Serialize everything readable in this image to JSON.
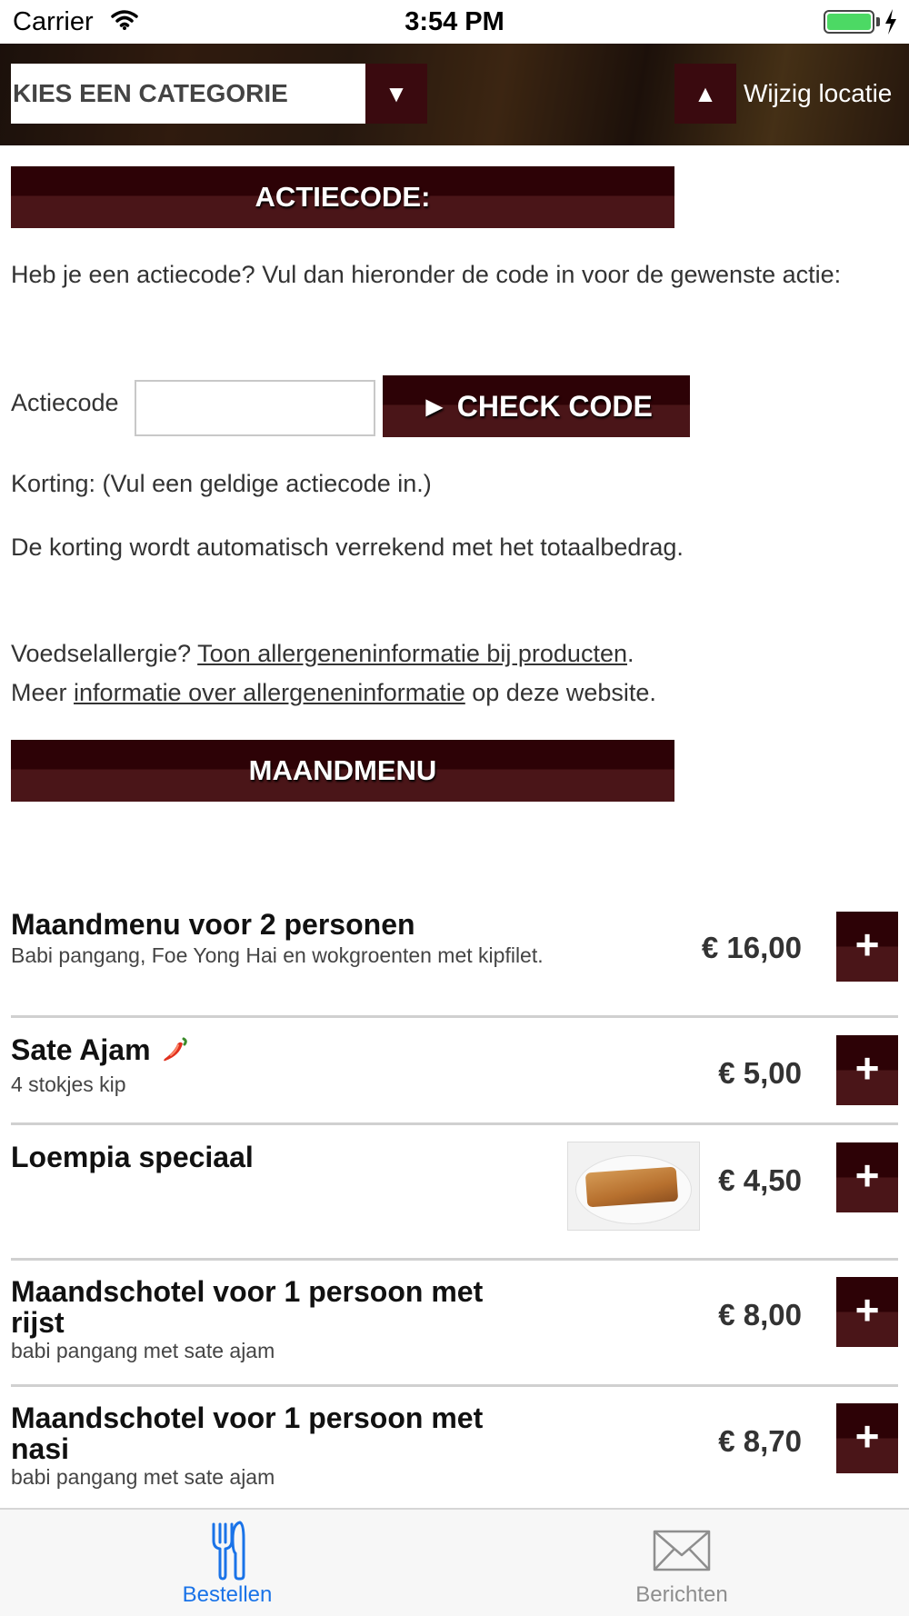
{
  "status_bar": {
    "carrier": "Carrier",
    "time": "3:54 PM"
  },
  "header": {
    "category_select": "KIES EEN CATEGORIE",
    "category_arrow": "▼",
    "location_arrow": "▲",
    "location_label": "Wijzig locatie"
  },
  "promo": {
    "title": "ACTIECODE:",
    "intro": "Heb je een actiecode? Vul dan hieronder de code in voor de gewenste actie:",
    "field_label": "Actiecode",
    "field_value": "",
    "check_button": "► CHECK CODE",
    "discount_text": "Korting: (Vul een geldige actiecode in.)",
    "note": "De korting wordt automatisch verrekend met het totaalbedrag."
  },
  "allergy": {
    "line1_prefix": "Voedselallergie? ",
    "line1_link": "Toon allergeneninformatie bij producten",
    "line1_suffix": ".",
    "line2_prefix": "Meer ",
    "line2_link": "informatie over allergeneninformatie",
    "line2_suffix": " op deze website."
  },
  "section": {
    "title": "MAANDMENU"
  },
  "menu_items": [
    {
      "name": "Maandmenu voor 2 personen",
      "desc": "Babi pangang, Foe Yong Hai en wokgroenten met kipfilet.",
      "price": "€ 16,00",
      "add": "+"
    },
    {
      "name": "Sate Ajam",
      "desc": "4 stokjes kip",
      "price": "€ 5,00",
      "add": "+",
      "spicy_icon": "chili-pepper-icon"
    },
    {
      "name": "Loempia speciaal",
      "desc": "",
      "price": "€ 4,50",
      "add": "+",
      "image": "loempia-photo"
    },
    {
      "name": "Maandschotel voor 1 persoon met rijst",
      "desc": "babi pangang met sate ajam",
      "price": "€ 8,00",
      "add": "+"
    },
    {
      "name": "Maandschotel voor 1 persoon met nasi",
      "desc": "babi pangang met sate ajam",
      "price": "€ 8,70",
      "add": "+"
    }
  ],
  "tabbar": {
    "tabs": [
      {
        "label": "Bestellen",
        "icon": "fork-knife-icon",
        "active": true
      },
      {
        "label": "Berichten",
        "icon": "envelope-icon",
        "active": false
      }
    ],
    "active_color": "#1a73e8",
    "inactive_color": "#8e8e8e"
  },
  "colors": {
    "accent": "#3a0a0f",
    "accent_light": "#4a1518"
  }
}
